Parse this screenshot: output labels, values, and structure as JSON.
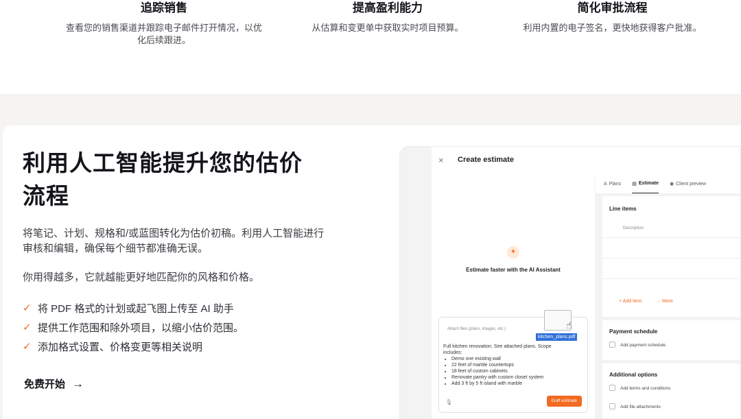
{
  "features": [
    {
      "title": "追踪销售",
      "text": "查看您的销售渠道并跟踪电子邮件打开情况，以优化后续跟进。"
    },
    {
      "title": "提高盈利能力",
      "text": "从估算和变更单中获取实时项目预算。"
    },
    {
      "title": "简化审批流程",
      "text": "利用内置的电子签名，更快地获得客户批准。"
    }
  ],
  "hero": {
    "headline": "利用人工智能提升您的估价流程",
    "desc1": "将笔记、计划、规格和/或蓝图转化为估价初稿。利用人工智能进行审核和编辑，确保每个细节都准确无误。",
    "desc2": "你用得越多，它就越能更好地匹配你的风格和价格。",
    "checks": [
      "将 PDF 格式的计划或起飞图上传至 AI 助手",
      "提供工作范围和除外项目，以缩小估价范围。",
      "添加格式设置、价格变更等相关说明"
    ],
    "cta": "免费开始",
    "cta_arrow": "→"
  },
  "app": {
    "title": "Create estimate",
    "close": "×",
    "ai_icon": "✦",
    "ai_text": "Estimate faster with the AI Assistant",
    "attach": "Attach files (plans, images, etc.)",
    "prompt_intro": "Full kitchen renovation. See attached plans. Scope includes:",
    "prompt_items": [
      "Demo one existing wall",
      "22 feet of marble countertops",
      "18 feet of custom cabinets",
      "Renovate pantry with custom closet system",
      "Add 3 ft by 5 ft island with marble"
    ],
    "file_name": "kitchen_plans.pdf",
    "draft_button": "Draft estimate",
    "mic_icon": "🎙",
    "tabs": [
      {
        "label": "Plans",
        "icon": "A"
      },
      {
        "label": "Estimate",
        "icon": "▤"
      },
      {
        "label": "Client preview",
        "icon": "◉"
      }
    ],
    "line_items_title": "Line items",
    "description_label": "Description",
    "add_item": "+ Add item",
    "more": "··· More",
    "payment_title": "Payment schedule",
    "payment_item": "Add payment schedule",
    "options_title": "Additional options",
    "option_items": [
      "Add terms and conditions",
      "Add file attachments"
    ]
  },
  "colors": {
    "accent": "#f26b21",
    "band": "#f5f4f2"
  }
}
